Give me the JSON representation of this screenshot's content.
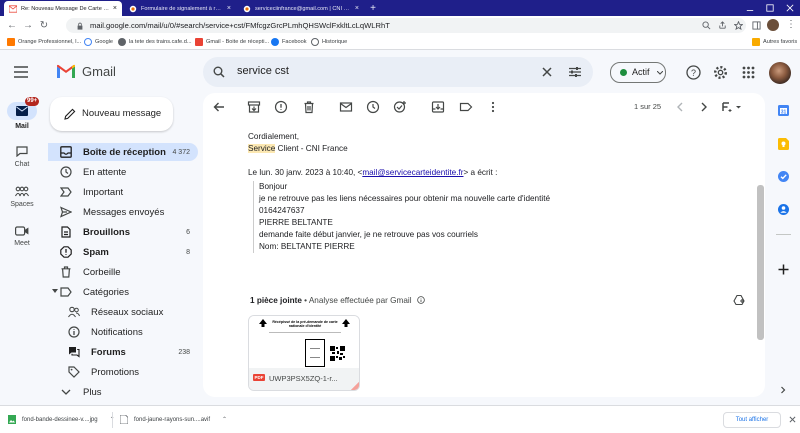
{
  "browser": {
    "tabs": [
      {
        "label": "Re: Nouveau Message De Carte nationale",
        "close": "×"
      },
      {
        "label": "Formulaire de signalement à remplir en ligne",
        "close": "×"
      },
      {
        "label": "serviceciinfrance@gmail.com | CNI France",
        "close": "×"
      }
    ],
    "new_tab": "+",
    "url": "mail.google.com/mail/u/0/#search/service+cst/FMfcgzGrcPLmhQHSWclFxkltLcLqWLRhT",
    "bookmarks": [
      "Orange Professionnel, l...",
      "Google",
      "la tete des trains.cafe.d...",
      "Gmail - Boite de récepti...",
      "Facebook",
      "Historique"
    ],
    "other_bookmarks": "Autres favoris"
  },
  "gmail": {
    "logo_text": "Gmail",
    "search_query": "service cst",
    "status_label": "Actif",
    "compose_label": "Nouveau message",
    "rail": [
      {
        "label": "Mail",
        "badge": "99+"
      },
      {
        "label": "Chat"
      },
      {
        "label": "Spaces"
      },
      {
        "label": "Meet"
      }
    ],
    "nav": [
      {
        "label": "Boîte de réception",
        "count": "4 372"
      },
      {
        "label": "En attente",
        "count": ""
      },
      {
        "label": "Important",
        "count": ""
      },
      {
        "label": "Messages envoyés",
        "count": ""
      },
      {
        "label": "Brouillons",
        "count": "6"
      },
      {
        "label": "Spam",
        "count": "8"
      },
      {
        "label": "Corbeille",
        "count": ""
      },
      {
        "label": "Catégories",
        "count": ""
      },
      {
        "label": "Réseaux sociaux",
        "count": ""
      },
      {
        "label": "Notifications",
        "count": ""
      },
      {
        "label": "Forums",
        "count": "238"
      },
      {
        "label": "Promotions",
        "count": ""
      },
      {
        "label": "Plus",
        "count": ""
      }
    ],
    "pager": "1 sur 25",
    "message": {
      "signoff": "Cordialement,",
      "sig_highlight": "Service",
      "sig_rest": " Client - CNI France",
      "quote_prefix": "Le lun. 30 janv. 2023 à 10:40, <",
      "quote_email": "mail@servicecarteidentite.fr",
      "quote_suffix": "> a écrit :",
      "quoted_lines": [
        "Bonjour",
        "je ne retrouve pas les liens nécessaires pour obtenir ma nouvelle carte d'identité",
        "0164247637",
        "PIERRE BELTANTE",
        "demande faite début janvier, je ne retrouve pas vos courriels",
        "Nom: BELTANTE PIERRE"
      ]
    },
    "attachments": {
      "header_bold": "1 pièce jointe",
      "header_rest": " • Analyse effectuée par Gmail",
      "file_name": "UWP3PSX5ZQ-1-r...",
      "file_type": "PDF",
      "thumb_title": "Récépissé de la pré-demande de carte nationale d'identité"
    }
  },
  "downloads": {
    "items": [
      "fond-bande-dessinee-v....jpg",
      "fond-jaune-rayons-sun....avif"
    ],
    "show_all": "Tout afficher"
  },
  "colors": {
    "gmail_red": "#ea4335",
    "gmail_blue": "#4285f4",
    "gmail_green": "#34a853",
    "gmail_yellow": "#fbbc04",
    "status_green": "#1e8e3e",
    "nav_selected": "#d3e3fd",
    "highlight": "#fce8b2",
    "link": "#1a0dab"
  }
}
